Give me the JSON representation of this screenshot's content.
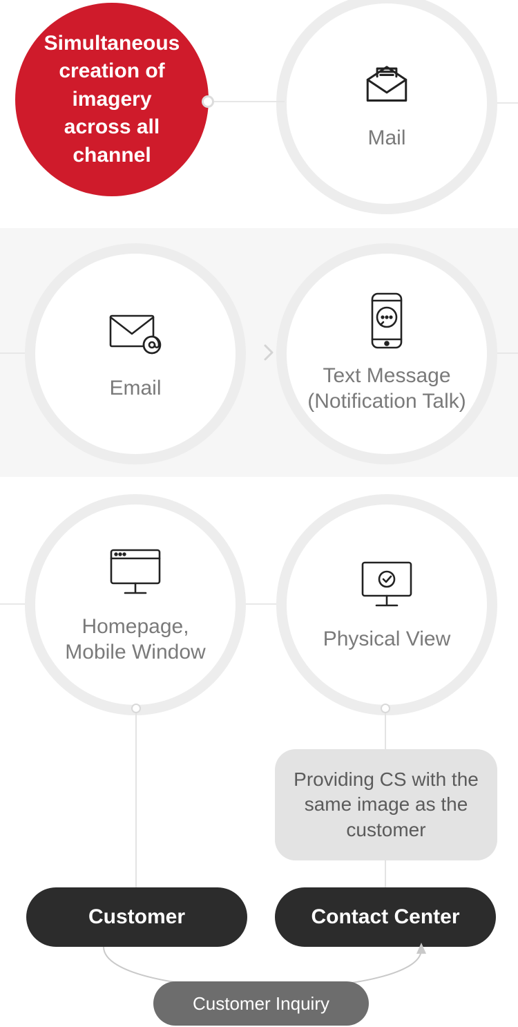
{
  "hero": {
    "text": "Simultaneous creation of imagery across all channel"
  },
  "nodes": {
    "mail": {
      "label": "Mail",
      "icon": "mail-open-icon"
    },
    "email": {
      "label": "Email",
      "icon": "email-at-icon"
    },
    "sms": {
      "label": "Text Message (Notification Talk)",
      "icon": "phone-chat-icon"
    },
    "home": {
      "label": "Homepage, Mobile Window",
      "icon": "monitor-window-icon"
    },
    "physical": {
      "label": "Physical View",
      "icon": "monitor-check-icon"
    }
  },
  "callout": {
    "text": "Providing CS with the same image as the customer"
  },
  "pills": {
    "customer": "Customer",
    "contact": "Contact Center",
    "inquiry": "Customer Inquiry"
  },
  "colors": {
    "accent": "#cf1b2b",
    "band": "#f6f6f6",
    "pill": "#2c2c2c",
    "callout": "#e3e3e3"
  }
}
